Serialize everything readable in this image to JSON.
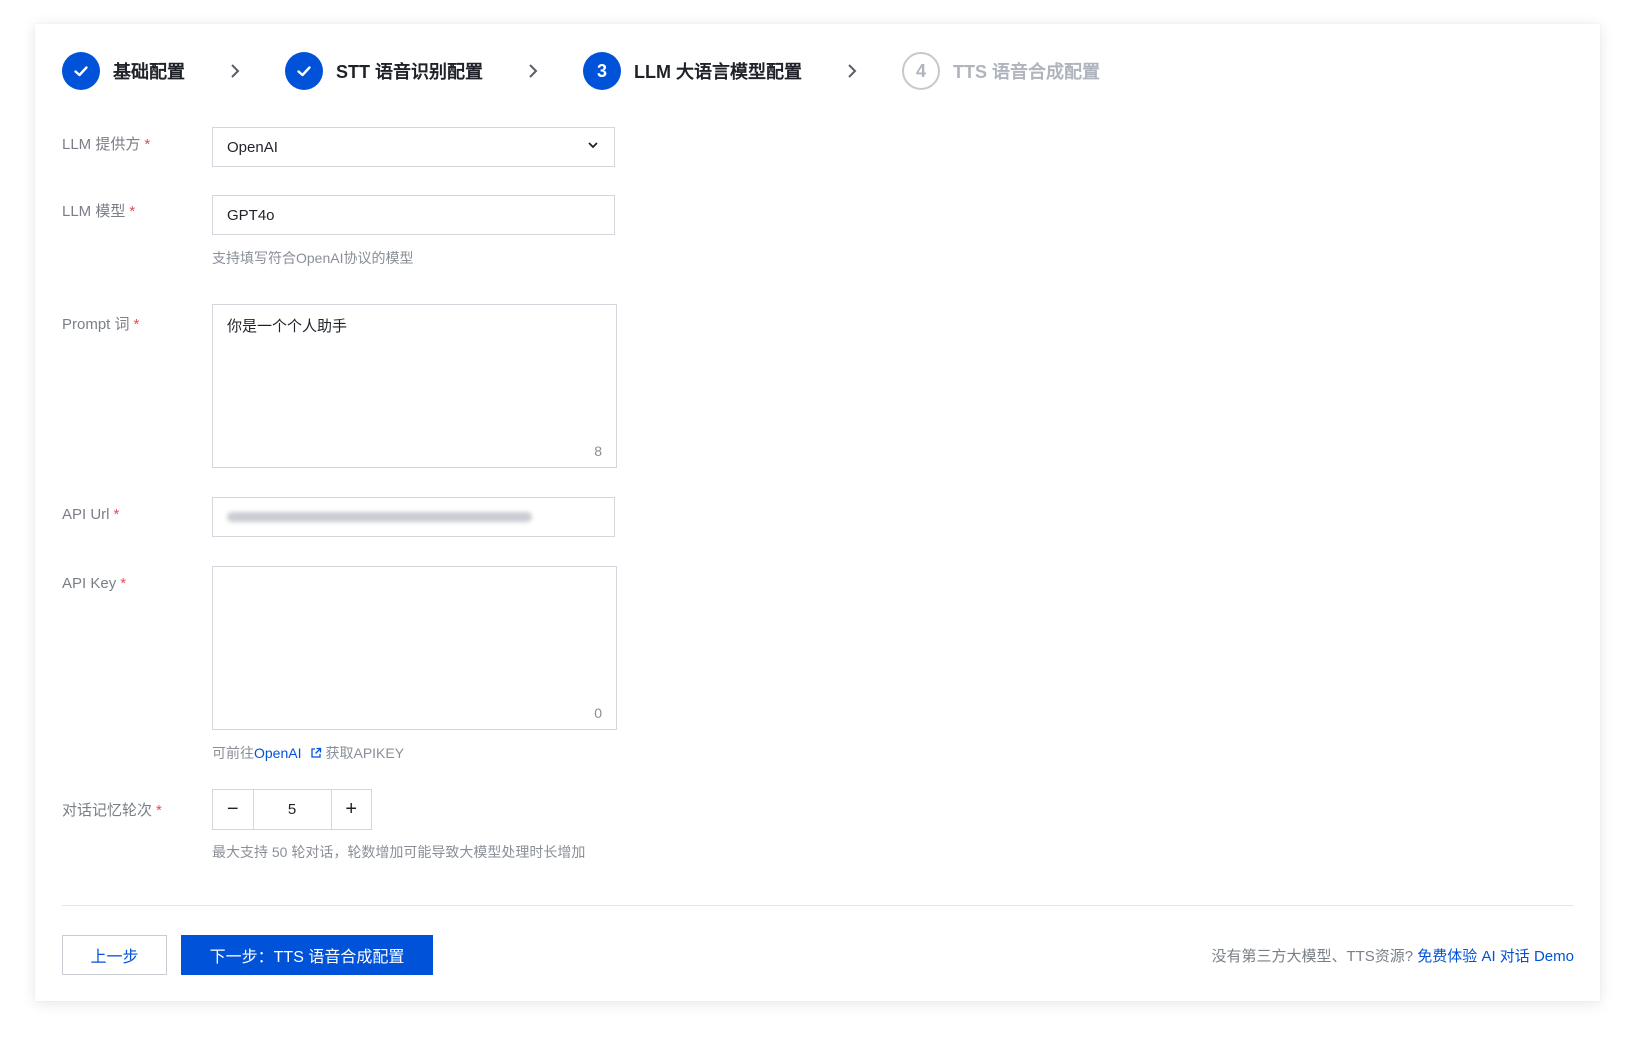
{
  "steps": [
    {
      "number": "",
      "title": "基础配置",
      "status": "done"
    },
    {
      "number": "",
      "title": "STT 语音识别配置",
      "status": "done"
    },
    {
      "number": "3",
      "title": "LLM 大语言模型配置",
      "status": "active"
    },
    {
      "number": "4",
      "title": "TTS 语音合成配置",
      "status": "pending"
    }
  ],
  "form": {
    "provider": {
      "label": "LLM 提供方",
      "value": "OpenAI"
    },
    "model": {
      "label": "LLM 模型",
      "value": "GPT4o",
      "help": "支持填写符合OpenAI协议的模型"
    },
    "prompt": {
      "label": "Prompt 词",
      "value": "你是一个个人助手",
      "count": "8"
    },
    "api_url": {
      "label": "API Url"
    },
    "api_key": {
      "label": "API Key",
      "value": "",
      "count": "0",
      "help_prefix": "可前往",
      "help_link": "OpenAI",
      "help_suffix": "获取APIKEY"
    },
    "memory": {
      "label": "对话记忆轮次",
      "value": "5",
      "minus": "−",
      "plus": "+",
      "help": "最大支持 50 轮对话，轮数增加可能导致大模型处理时长增加"
    }
  },
  "footer": {
    "prev_label": "上一步",
    "next_label": "下一步：TTS 语音合成配置",
    "note_text": "没有第三方大模型、TTS资源?",
    "note_link": "免费体验 AI 对话 Demo"
  },
  "colors": {
    "primary": "#0052d9",
    "required": "#e34d59"
  }
}
